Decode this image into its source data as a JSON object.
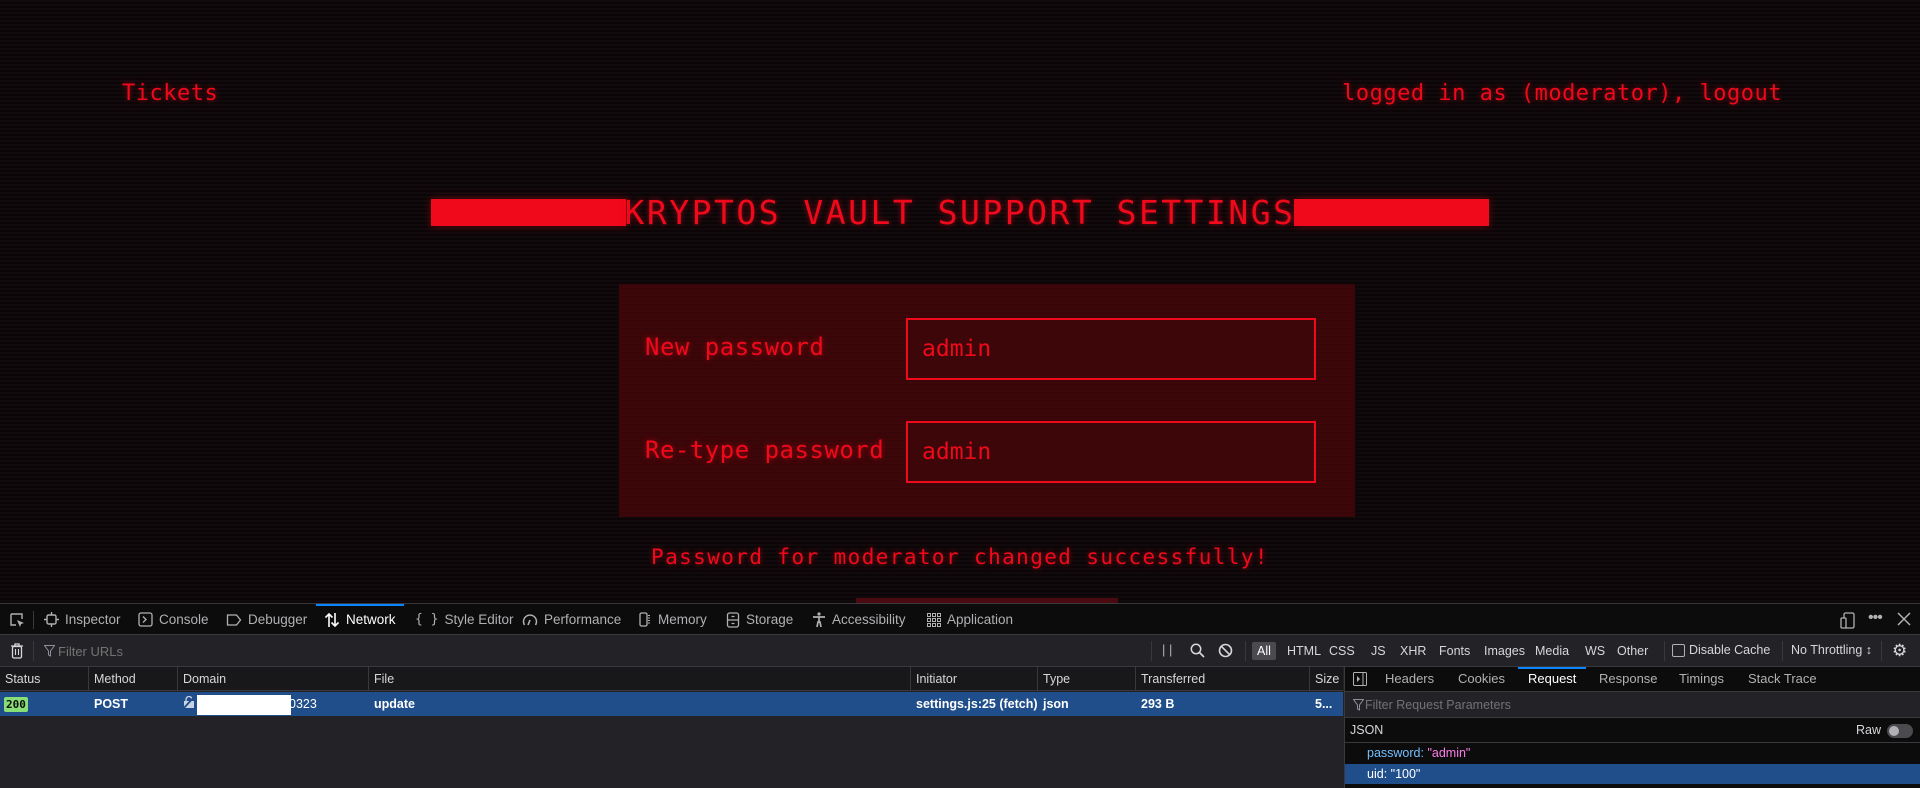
{
  "page": {
    "nav": {
      "tickets_label": "Tickets",
      "user_prefix": "logged in as (moderator), ",
      "logout_label": "logout"
    },
    "title": "KRYPTOS VAULT SUPPORT SETTINGS",
    "form": {
      "new_password_label": "New password",
      "new_password_value": "admin",
      "retype_password_label": "Re-type password",
      "retype_password_value": "admin"
    },
    "success_message": "Password for moderator changed successfully!",
    "colors": {
      "accent": "#f0091b",
      "panel": "#3d0609",
      "background": "#0c0507"
    }
  },
  "devtools": {
    "toolbar": {
      "pick_element_icon": "pick-element-icon",
      "tabs": [
        {
          "label": "Inspector",
          "icon": "inspector-icon"
        },
        {
          "label": "Console",
          "icon": "console-icon"
        },
        {
          "label": "Debugger",
          "icon": "debugger-icon"
        },
        {
          "label": "Network",
          "icon": "network-icon",
          "active": true
        },
        {
          "label": "Style Editor",
          "icon": "style-editor-icon"
        },
        {
          "label": "Performance",
          "icon": "performance-icon"
        },
        {
          "label": "Memory",
          "icon": "memory-icon"
        },
        {
          "label": "Storage",
          "icon": "storage-icon"
        },
        {
          "label": "Accessibility",
          "icon": "accessibility-icon"
        },
        {
          "label": "Application",
          "icon": "application-icon"
        }
      ]
    },
    "filterbar": {
      "filter_placeholder": "Filter URLs",
      "type_filters": [
        "All",
        "HTML",
        "CSS",
        "JS",
        "XHR",
        "Fonts",
        "Images",
        "Media",
        "WS",
        "Other"
      ],
      "active_type": "All",
      "disable_cache_label": "Disable Cache",
      "throttling_label": "No Throttling ↕"
    },
    "request_table": {
      "columns": [
        "Status",
        "Method",
        "Domain",
        "File",
        "Initiator",
        "Type",
        "Transferred",
        "Size"
      ],
      "rows": [
        {
          "status": "200",
          "method": "POST",
          "domain_suffix": "0323",
          "file": "update",
          "initiator": "settings.js:25 (fetch)",
          "type": "json",
          "transferred": "293 B",
          "size": "5..."
        }
      ]
    },
    "side_panel": {
      "tabs": [
        "Headers",
        "Cookies",
        "Request",
        "Response",
        "Timings",
        "Stack Trace"
      ],
      "active_tab": "Request",
      "filter_placeholder": "Filter Request Parameters",
      "json_label": "JSON",
      "raw_label": "Raw",
      "params": [
        {
          "key": "password",
          "value": "\"admin\""
        },
        {
          "key": "uid",
          "value": "\"100\"",
          "selected": true
        }
      ]
    }
  }
}
